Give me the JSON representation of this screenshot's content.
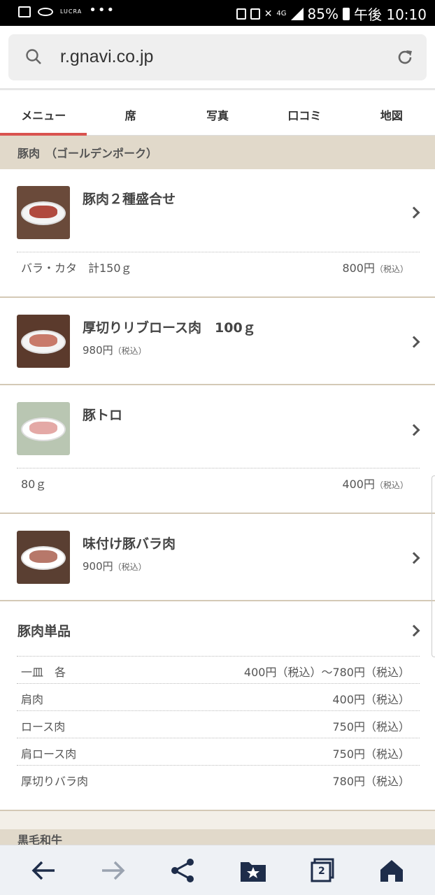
{
  "status": {
    "battery": "85%",
    "time": "午後 10:10",
    "network": "4G",
    "carrier_logo": "LUCRA"
  },
  "browser": {
    "url": "r.gnavi.co.jp"
  },
  "tabs": [
    {
      "label": "メニュー"
    },
    {
      "label": "席"
    },
    {
      "label": "写真"
    },
    {
      "label": "口コミ"
    },
    {
      "label": "地図"
    }
  ],
  "section1": {
    "title": "豚肉　（ゴールデンポーク）"
  },
  "items": [
    {
      "name": "豚肉２種盛合せ",
      "sub": "バラ・カタ　計150ｇ",
      "price": "800円",
      "tax": "（税込）"
    },
    {
      "name": "厚切りリブロース肉　100ｇ",
      "price": "980円",
      "tax": "（税込）"
    },
    {
      "name": "豚トロ",
      "sub": "80ｇ",
      "price": "400円",
      "tax": "（税込）"
    },
    {
      "name": "味付け豚バラ肉",
      "price": "900円",
      "tax": "（税込）"
    }
  ],
  "single": {
    "title": "豚肉単品",
    "rows": [
      {
        "label": "一皿　各",
        "price": "400円（税込）〜780円（税込）"
      },
      {
        "label": "肩肉",
        "price": "400円（税込）"
      },
      {
        "label": "ロース肉",
        "price": "750円（税込）"
      },
      {
        "label": "肩ロース肉",
        "price": "750円（税込）"
      },
      {
        "label": "厚切りバラ肉",
        "price": "780円（税込）"
      }
    ]
  },
  "section2": {
    "title": "黒毛和牛"
  },
  "bottom_nav": {
    "tabs_count": "2"
  }
}
